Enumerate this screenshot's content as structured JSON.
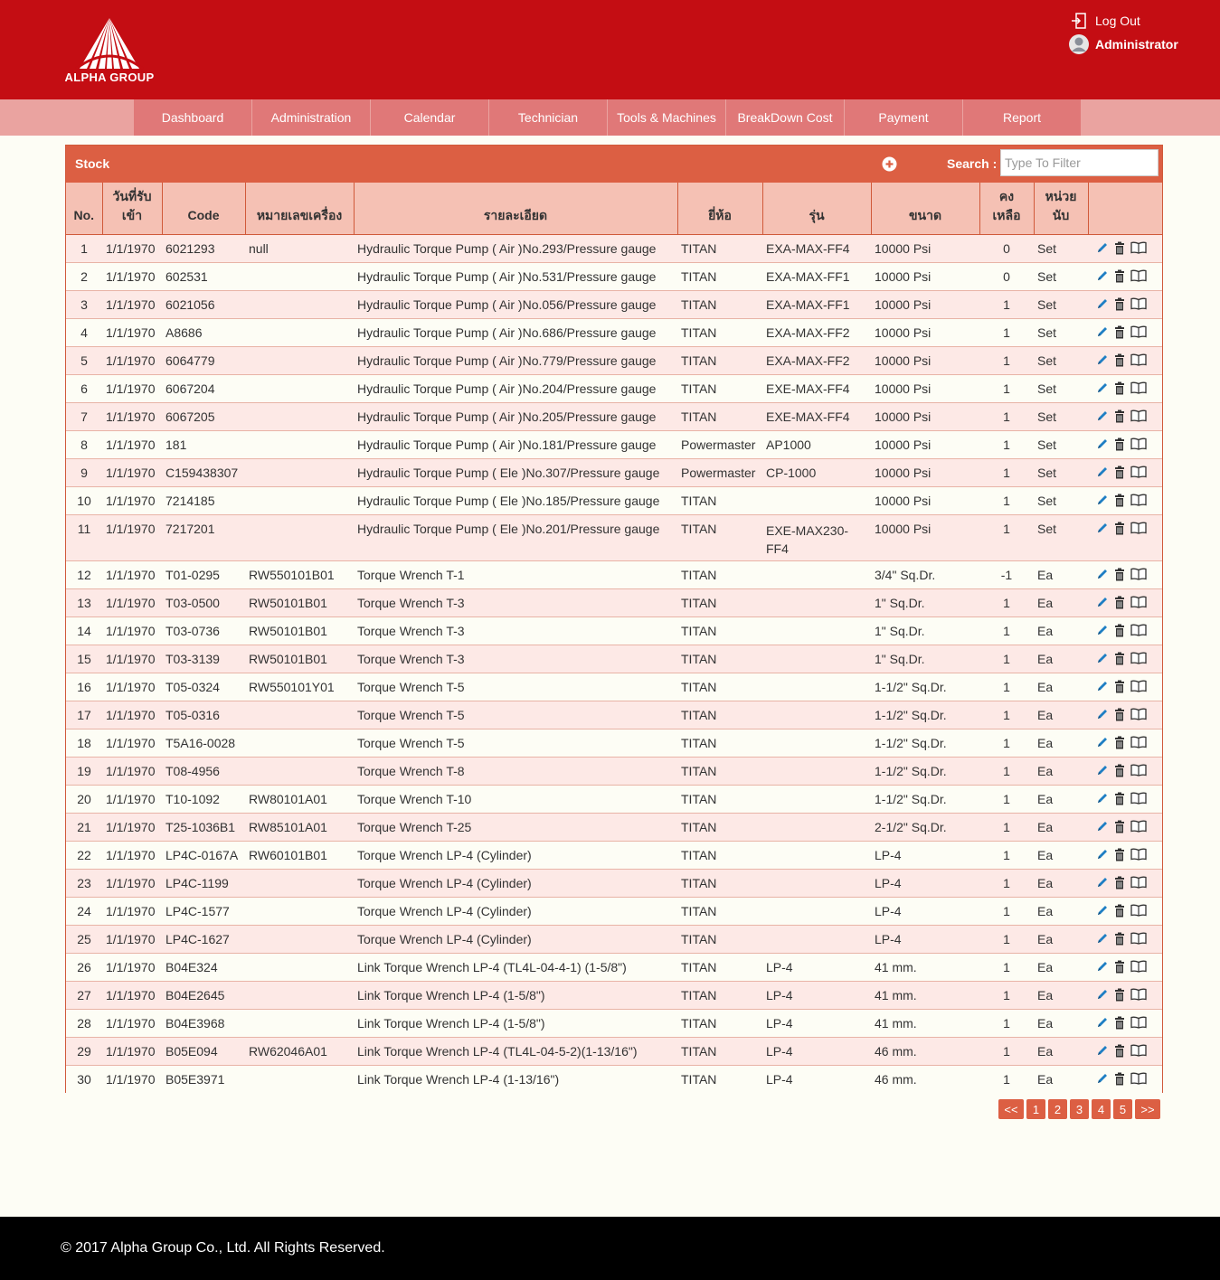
{
  "header": {
    "logo_text": "ALPHA GROUP",
    "logout_label": "Log Out",
    "user_name": "Administrator"
  },
  "nav": {
    "items": [
      "Dashboard",
      "Administration",
      "Calendar",
      "Technician",
      "Tools & Machines",
      "BreakDown Cost",
      "Payment",
      "Report"
    ]
  },
  "panel": {
    "title": "Stock",
    "search_label": "Search :",
    "search_placeholder": "Type To Filter"
  },
  "table": {
    "headers": [
      "No.",
      "วันที่รับ เข้า",
      "Code",
      "หมายเลขเครื่อง",
      "รายละเอียด",
      "ยี่ห้อ",
      "รุ่น",
      "ขนาด",
      "คง เหลือ",
      "หน่วย นับ",
      ""
    ],
    "rows": [
      [
        "1",
        "1/1/1970",
        "6021293",
        "null",
        "Hydraulic Torque Pump ( Air )No.293/Pressure gauge",
        "TITAN",
        "EXA-MAX-FF4",
        "10000 Psi",
        "0",
        "Set"
      ],
      [
        "2",
        "1/1/1970",
        "602531",
        "",
        "Hydraulic Torque Pump ( Air )No.531/Pressure gauge",
        "TITAN",
        "EXA-MAX-FF1",
        "10000 Psi",
        "0",
        "Set"
      ],
      [
        "3",
        "1/1/1970",
        "6021056",
        "",
        "Hydraulic Torque Pump ( Air )No.056/Pressure gauge",
        "TITAN",
        "EXA-MAX-FF1",
        "10000 Psi",
        "1",
        "Set"
      ],
      [
        "4",
        "1/1/1970",
        "A8686",
        "",
        "Hydraulic Torque Pump ( Air )No.686/Pressure gauge",
        "TITAN",
        "EXA-MAX-FF2",
        "10000 Psi",
        "1",
        "Set"
      ],
      [
        "5",
        "1/1/1970",
        "6064779",
        "",
        "Hydraulic Torque Pump ( Air )No.779/Pressure gauge",
        "TITAN",
        "EXA-MAX-FF2",
        "10000 Psi",
        "1",
        "Set"
      ],
      [
        "6",
        "1/1/1970",
        "6067204",
        "",
        "Hydraulic Torque Pump ( Air )No.204/Pressure gauge",
        "TITAN",
        "EXE-MAX-FF4",
        "10000 Psi",
        "1",
        "Set"
      ],
      [
        "7",
        "1/1/1970",
        "6067205",
        "",
        "Hydraulic Torque Pump ( Air )No.205/Pressure gauge",
        "TITAN",
        "EXE-MAX-FF4",
        "10000 Psi",
        "1",
        "Set"
      ],
      [
        "8",
        "1/1/1970",
        "181",
        "",
        "Hydraulic Torque Pump ( Air )No.181/Pressure gauge",
        "Powermaster",
        "AP1000",
        "10000 Psi",
        "1",
        "Set"
      ],
      [
        "9",
        "1/1/1970",
        "C159438307",
        "",
        "Hydraulic Torque Pump ( Ele )No.307/Pressure gauge",
        "Powermaster",
        "CP-1000",
        "10000 Psi",
        "1",
        "Set"
      ],
      [
        "10",
        "1/1/1970",
        "7214185",
        "",
        "Hydraulic Torque Pump ( Ele )No.185/Pressure gauge",
        "TITAN",
        "",
        "10000 Psi",
        "1",
        "Set"
      ],
      [
        "11",
        "1/1/1970",
        "7217201",
        "",
        "Hydraulic Torque Pump ( Ele )No.201/Pressure gauge",
        "TITAN",
        "EXE-MAX230-FF4",
        "10000 Psi",
        "1",
        "Set"
      ],
      [
        "12",
        "1/1/1970",
        "T01-0295",
        "RW550101B01",
        "Torque Wrench T-1",
        "TITAN",
        "",
        "3/4\" Sq.Dr.",
        "-1",
        "Ea"
      ],
      [
        "13",
        "1/1/1970",
        "T03-0500",
        "RW50101B01",
        "Torque Wrench T-3",
        "TITAN",
        "",
        "1\" Sq.Dr.",
        "1",
        "Ea"
      ],
      [
        "14",
        "1/1/1970",
        "T03-0736",
        "RW50101B01",
        "Torque Wrench T-3",
        "TITAN",
        "",
        "1\" Sq.Dr.",
        "1",
        "Ea"
      ],
      [
        "15",
        "1/1/1970",
        "T03-3139",
        "RW50101B01",
        "Torque Wrench T-3",
        "TITAN",
        "",
        "1\" Sq.Dr.",
        "1",
        "Ea"
      ],
      [
        "16",
        "1/1/1970",
        "T05-0324",
        "RW550101Y01",
        "Torque Wrench T-5",
        "TITAN",
        "",
        "1-1/2\" Sq.Dr.",
        "1",
        "Ea"
      ],
      [
        "17",
        "1/1/1970",
        "T05-0316",
        "",
        "Torque Wrench T-5",
        "TITAN",
        "",
        "1-1/2\" Sq.Dr.",
        "1",
        "Ea"
      ],
      [
        "18",
        "1/1/1970",
        "T5A16-0028",
        "",
        "Torque Wrench T-5",
        "TITAN",
        "",
        "1-1/2\" Sq.Dr.",
        "1",
        "Ea"
      ],
      [
        "19",
        "1/1/1970",
        "T08-4956",
        "",
        "Torque Wrench T-8",
        "TITAN",
        "",
        "1-1/2\" Sq.Dr.",
        "1",
        "Ea"
      ],
      [
        "20",
        "1/1/1970",
        "T10-1092",
        "RW80101A01",
        "Torque Wrench T-10",
        "TITAN",
        "",
        "1-1/2\" Sq.Dr.",
        "1",
        "Ea"
      ],
      [
        "21",
        "1/1/1970",
        "T25-1036B1",
        "RW85101A01",
        "Torque Wrench T-25",
        "TITAN",
        "",
        "2-1/2\" Sq.Dr.",
        "1",
        "Ea"
      ],
      [
        "22",
        "1/1/1970",
        "LP4C-0167A",
        "RW60101B01",
        "Torque Wrench LP-4 (Cylinder)",
        "TITAN",
        "",
        "LP-4",
        "1",
        "Ea"
      ],
      [
        "23",
        "1/1/1970",
        "LP4C-1199",
        "",
        "Torque Wrench LP-4 (Cylinder)",
        "TITAN",
        "",
        "LP-4",
        "1",
        "Ea"
      ],
      [
        "24",
        "1/1/1970",
        "LP4C-1577",
        "",
        "Torque Wrench LP-4 (Cylinder)",
        "TITAN",
        "",
        "LP-4",
        "1",
        "Ea"
      ],
      [
        "25",
        "1/1/1970",
        "LP4C-1627",
        "",
        "Torque Wrench LP-4 (Cylinder)",
        "TITAN",
        "",
        "LP-4",
        "1",
        "Ea"
      ],
      [
        "26",
        "1/1/1970",
        "B04E324",
        "",
        "Link Torque Wrench LP-4 (TL4L-04-4-1) (1-5/8\")",
        "TITAN",
        "LP-4",
        "41 mm.",
        "1",
        "Ea"
      ],
      [
        "27",
        "1/1/1970",
        "B04E2645",
        "",
        "Link Torque Wrench LP-4 (1-5/8\")",
        "TITAN",
        "LP-4",
        "41 mm.",
        "1",
        "Ea"
      ],
      [
        "28",
        "1/1/1970",
        "B04E3968",
        "",
        "Link Torque Wrench LP-4 (1-5/8\")",
        "TITAN",
        "LP-4",
        "41 mm.",
        "1",
        "Ea"
      ],
      [
        "29",
        "1/1/1970",
        "B05E094",
        "RW62046A01",
        "Link Torque Wrench LP-4 (TL4L-04-5-2)(1-13/16\")",
        "TITAN",
        "LP-4",
        "46 mm.",
        "1",
        "Ea"
      ],
      [
        "30",
        "1/1/1970",
        "B05E3971",
        "",
        "Link Torque Wrench LP-4 (1-13/16\")",
        "TITAN",
        "LP-4",
        "46 mm.",
        "1",
        "Ea"
      ]
    ],
    "row_actions": [
      "pencil-icon",
      "trash-icon",
      "book-icon"
    ]
  },
  "pagination": [
    "<<",
    "1",
    "2",
    "3",
    "4",
    "5",
    ">>"
  ],
  "footer": {
    "copyright": "© 2017 Alpha Group Co., Ltd. All Rights Reserved."
  },
  "colors": {
    "brand_red": "#c40d13",
    "nav_item": "#e07878",
    "panel_header": "#dc5f43",
    "table_header": "#f5c1b4",
    "row_odd": "#fde9e6",
    "row_even": "#fdfdf5"
  }
}
